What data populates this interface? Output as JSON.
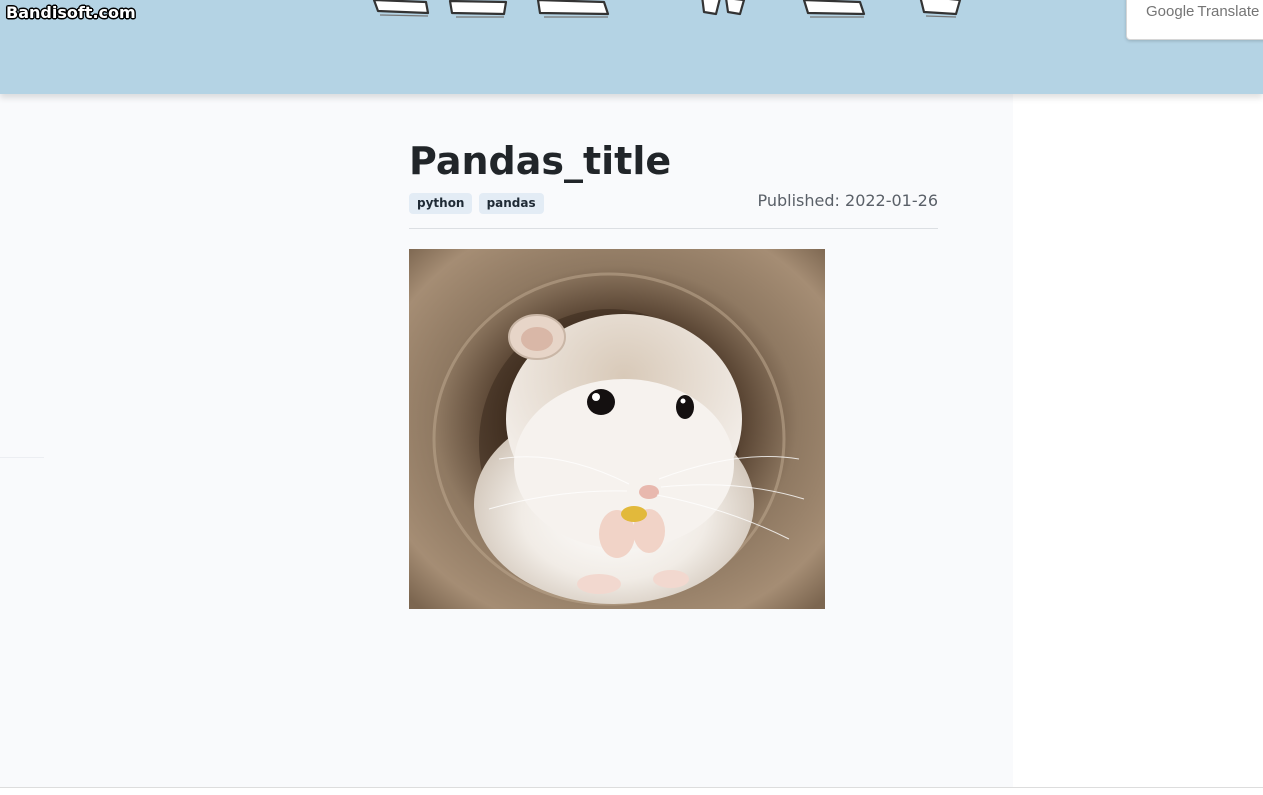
{
  "header": {
    "watermark": "Bandisoft.com",
    "background_color": "#b4d3e4",
    "banner_art_icon": "decorative-banner-art-icon"
  },
  "translate_widget": {
    "brand": "Google",
    "label": "Translate"
  },
  "article": {
    "title": "Pandas_title",
    "tags": [
      "python",
      "pandas"
    ],
    "published": "Published: 2022-01-26",
    "image": {
      "icon": "hamster-photo",
      "subject_colors": {
        "background": "#7a6450",
        "fur": "#f2ece6"
      }
    }
  },
  "colors": {
    "content_background": "#f9fafc",
    "tag_background": "#e3ecf5",
    "title_text": "#212529"
  }
}
